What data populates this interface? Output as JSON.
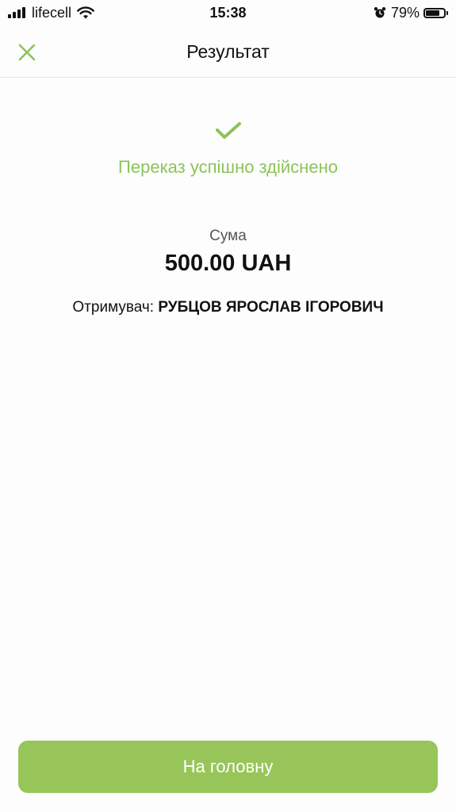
{
  "status_bar": {
    "carrier": "lifecell",
    "time": "15:38",
    "battery_percent": "79%",
    "battery_level": 0.79,
    "icons": [
      "signal-icon",
      "wifi-icon",
      "alarm-icon",
      "battery-icon"
    ]
  },
  "header": {
    "title": "Результат",
    "close_icon": "close-icon"
  },
  "result": {
    "status_icon": "check-icon",
    "status_text": "Переказ успішно здійснено",
    "amount_label": "Сума",
    "amount_value": "500.00 UAH",
    "recipient_label": "Отримувач:",
    "recipient_name": "РУБЦОВ ЯРОСЛАВ ІГОРОВИЧ"
  },
  "footer": {
    "home_button_label": "На головну"
  },
  "colors": {
    "accent": "#98c55a",
    "success_text": "#8cc35a",
    "background": "#fdfdfd"
  }
}
